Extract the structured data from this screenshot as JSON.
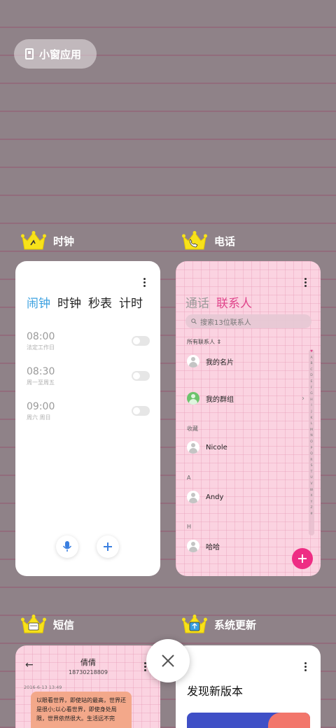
{
  "floating": {
    "label": "小窗应用",
    "icon": "floating-window-icon"
  },
  "apps": [
    {
      "name": "时钟",
      "icon": "clock-app-icon",
      "tabs": [
        "闹钟",
        "时钟",
        "秒表",
        "计时"
      ],
      "active_tab": 0,
      "alarms": [
        {
          "time": "08:00",
          "repeat": "法定工作日"
        },
        {
          "time": "08:30",
          "repeat": "周一至周五"
        },
        {
          "time": "09:00",
          "repeat": "周六 周日"
        }
      ]
    },
    {
      "name": "电话",
      "icon": "phone-app-icon",
      "tabs": [
        "通话",
        "联系人"
      ],
      "active_tab": 1,
      "search_placeholder": "搜索13位联系人",
      "filter_label": "所有联系人",
      "my_card": "我的名片",
      "my_groups": "我的群组",
      "sections": [
        {
          "header": "收藏",
          "contact": "Nicole"
        },
        {
          "header": "A",
          "contact": "Andy"
        },
        {
          "header": "H",
          "contact": "哈哈"
        }
      ],
      "index_letters": [
        "♥",
        "A",
        "B",
        "C",
        "D",
        "E",
        "F",
        "G",
        "H",
        "I",
        "J",
        "K",
        "L",
        "M",
        "N",
        "O",
        "P",
        "Q",
        "R",
        "S",
        "T",
        "U",
        "V",
        "W",
        "X",
        "Y",
        "Z",
        "#"
      ]
    },
    {
      "name": "短信",
      "icon": "sms-app-icon",
      "contact_name": "倩倩",
      "contact_number": "18730218809",
      "date": "2016-6-13 13:49",
      "message": "以眼看世界，即使站的最高，世界还是很小;以心看世界，即使身处局限，世界依然很大。生活远不完"
    },
    {
      "name": "系统更新",
      "icon": "system-update-app-icon",
      "headline": "发现新版本"
    }
  ],
  "colors": {
    "accent_blue": "#3aa0e0",
    "accent_pink": "#e0468c",
    "fab_pink": "#ee2d84"
  }
}
